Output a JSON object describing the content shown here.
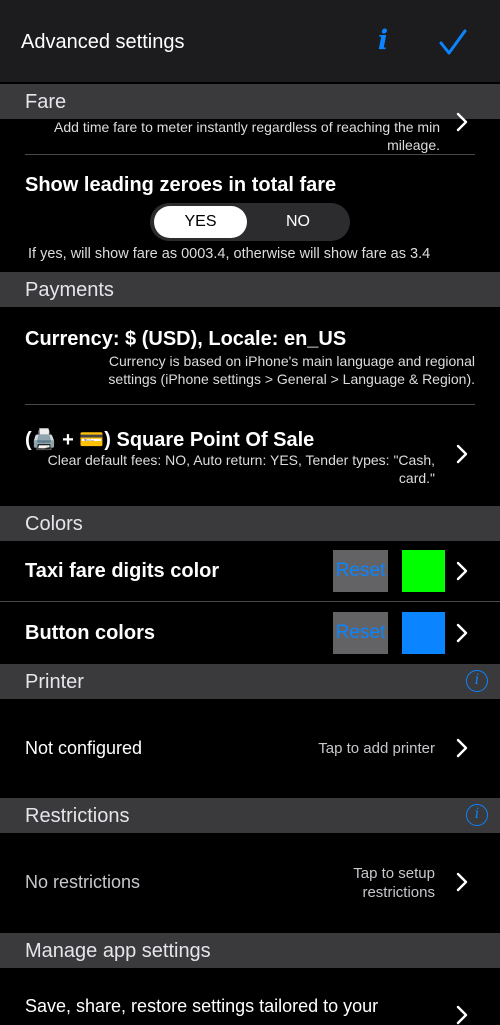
{
  "navbar": {
    "title": "Advanced settings",
    "info_glyph": "i",
    "info_icon": "info-icon",
    "done_icon": "checkmark-icon"
  },
  "fare": {
    "header": "Fare",
    "time_fare_note": "Add time fare to meter instantly regardless of reaching the min mileage.",
    "leading_zeroes_title": "Show leading zeroes in total fare",
    "toggle": {
      "yes": "YES",
      "no": "NO",
      "selected": "YES"
    },
    "leading_zeroes_note": "If yes, will show fare as 0003.4, otherwise will show fare as 3.4"
  },
  "payments": {
    "header": "Payments",
    "currency_title": "Currency: $ (USD), Locale: en_US",
    "currency_note": "Currency is based on iPhone's main language and regional settings (iPhone settings > General > Language & Region).",
    "square_title": "(🖨️ + 💳) Square Point Of Sale",
    "square_note": "Clear default fees: NO, Auto return: YES, Tender types: \"Cash, card.\""
  },
  "colors": {
    "header": "Colors",
    "digits_label": "Taxi fare digits color",
    "digits_reset": "Reset",
    "digits_color": "#00ff00",
    "buttons_label": "Button colors",
    "buttons_reset": "Reset",
    "buttons_color": "#0a84ff"
  },
  "printer": {
    "header": "Printer",
    "status": "Not configured",
    "action": "Tap to add printer"
  },
  "restrictions": {
    "header": "Restrictions",
    "status": "No restrictions",
    "action": "Tap to setup restrictions"
  },
  "manage": {
    "header": "Manage app settings",
    "description": "Save, share, restore settings tailored to your"
  },
  "accent_color": "#0a84ff"
}
